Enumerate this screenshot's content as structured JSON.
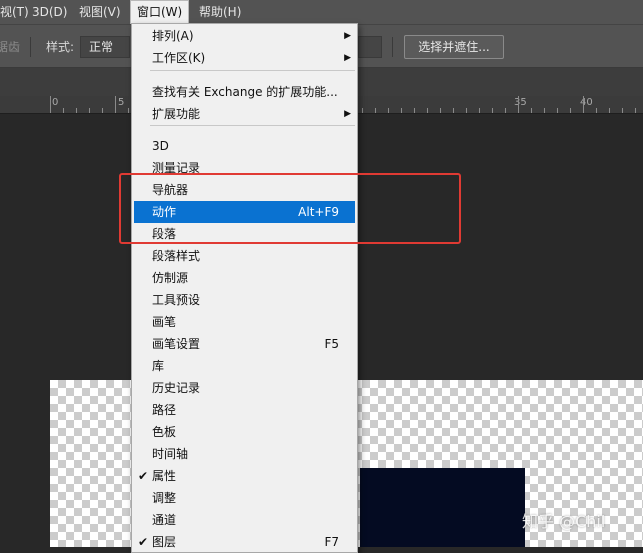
{
  "menubar": {
    "items": [
      "视(T)",
      "3D(D)",
      "视图(V)",
      "窗口(W)",
      "帮助(H)"
    ],
    "active_index": 3
  },
  "options_bar": {
    "feather_label": "消除锯齿",
    "style_label": "样式:",
    "style_value": "正常",
    "refine_button": "选择并遮住..."
  },
  "ruler": {
    "numbers": [
      "0",
      "5",
      "35",
      "40"
    ]
  },
  "window_menu": {
    "items": [
      {
        "label": "排列(A)",
        "submenu": true
      },
      {
        "label": "工作区(K)",
        "submenu": true
      },
      {
        "label": "查找有关 Exchange 的扩展功能...",
        "shortcut": ""
      },
      {
        "label": "扩展功能",
        "submenu": true
      },
      {
        "label": "3D"
      },
      {
        "label": "测量记录"
      },
      {
        "label": "导航器"
      },
      {
        "label": "动作",
        "shortcut": "Alt+F9",
        "highlighted": true
      },
      {
        "label": "段落"
      },
      {
        "label": "段落样式"
      },
      {
        "label": "仿制源"
      },
      {
        "label": "工具预设"
      },
      {
        "label": "画笔"
      },
      {
        "label": "画笔设置",
        "shortcut": "F5"
      },
      {
        "label": "库"
      },
      {
        "label": "历史记录"
      },
      {
        "label": "路径"
      },
      {
        "label": "色板"
      },
      {
        "label": "时间轴"
      },
      {
        "label": "属性",
        "checked": true
      },
      {
        "label": "调整"
      },
      {
        "label": "通道"
      },
      {
        "label": "图层",
        "shortcut": "F7",
        "checked": true
      }
    ]
  },
  "watermark": "知乎 @Chil",
  "colors": {
    "menu_highlight": "#0a72d1",
    "annotation_red": "#e03a33",
    "canvas_fill": "#040b22"
  },
  "icons": {
    "submenu": "chevron-right-icon",
    "checkmark": "checkmark-icon"
  }
}
